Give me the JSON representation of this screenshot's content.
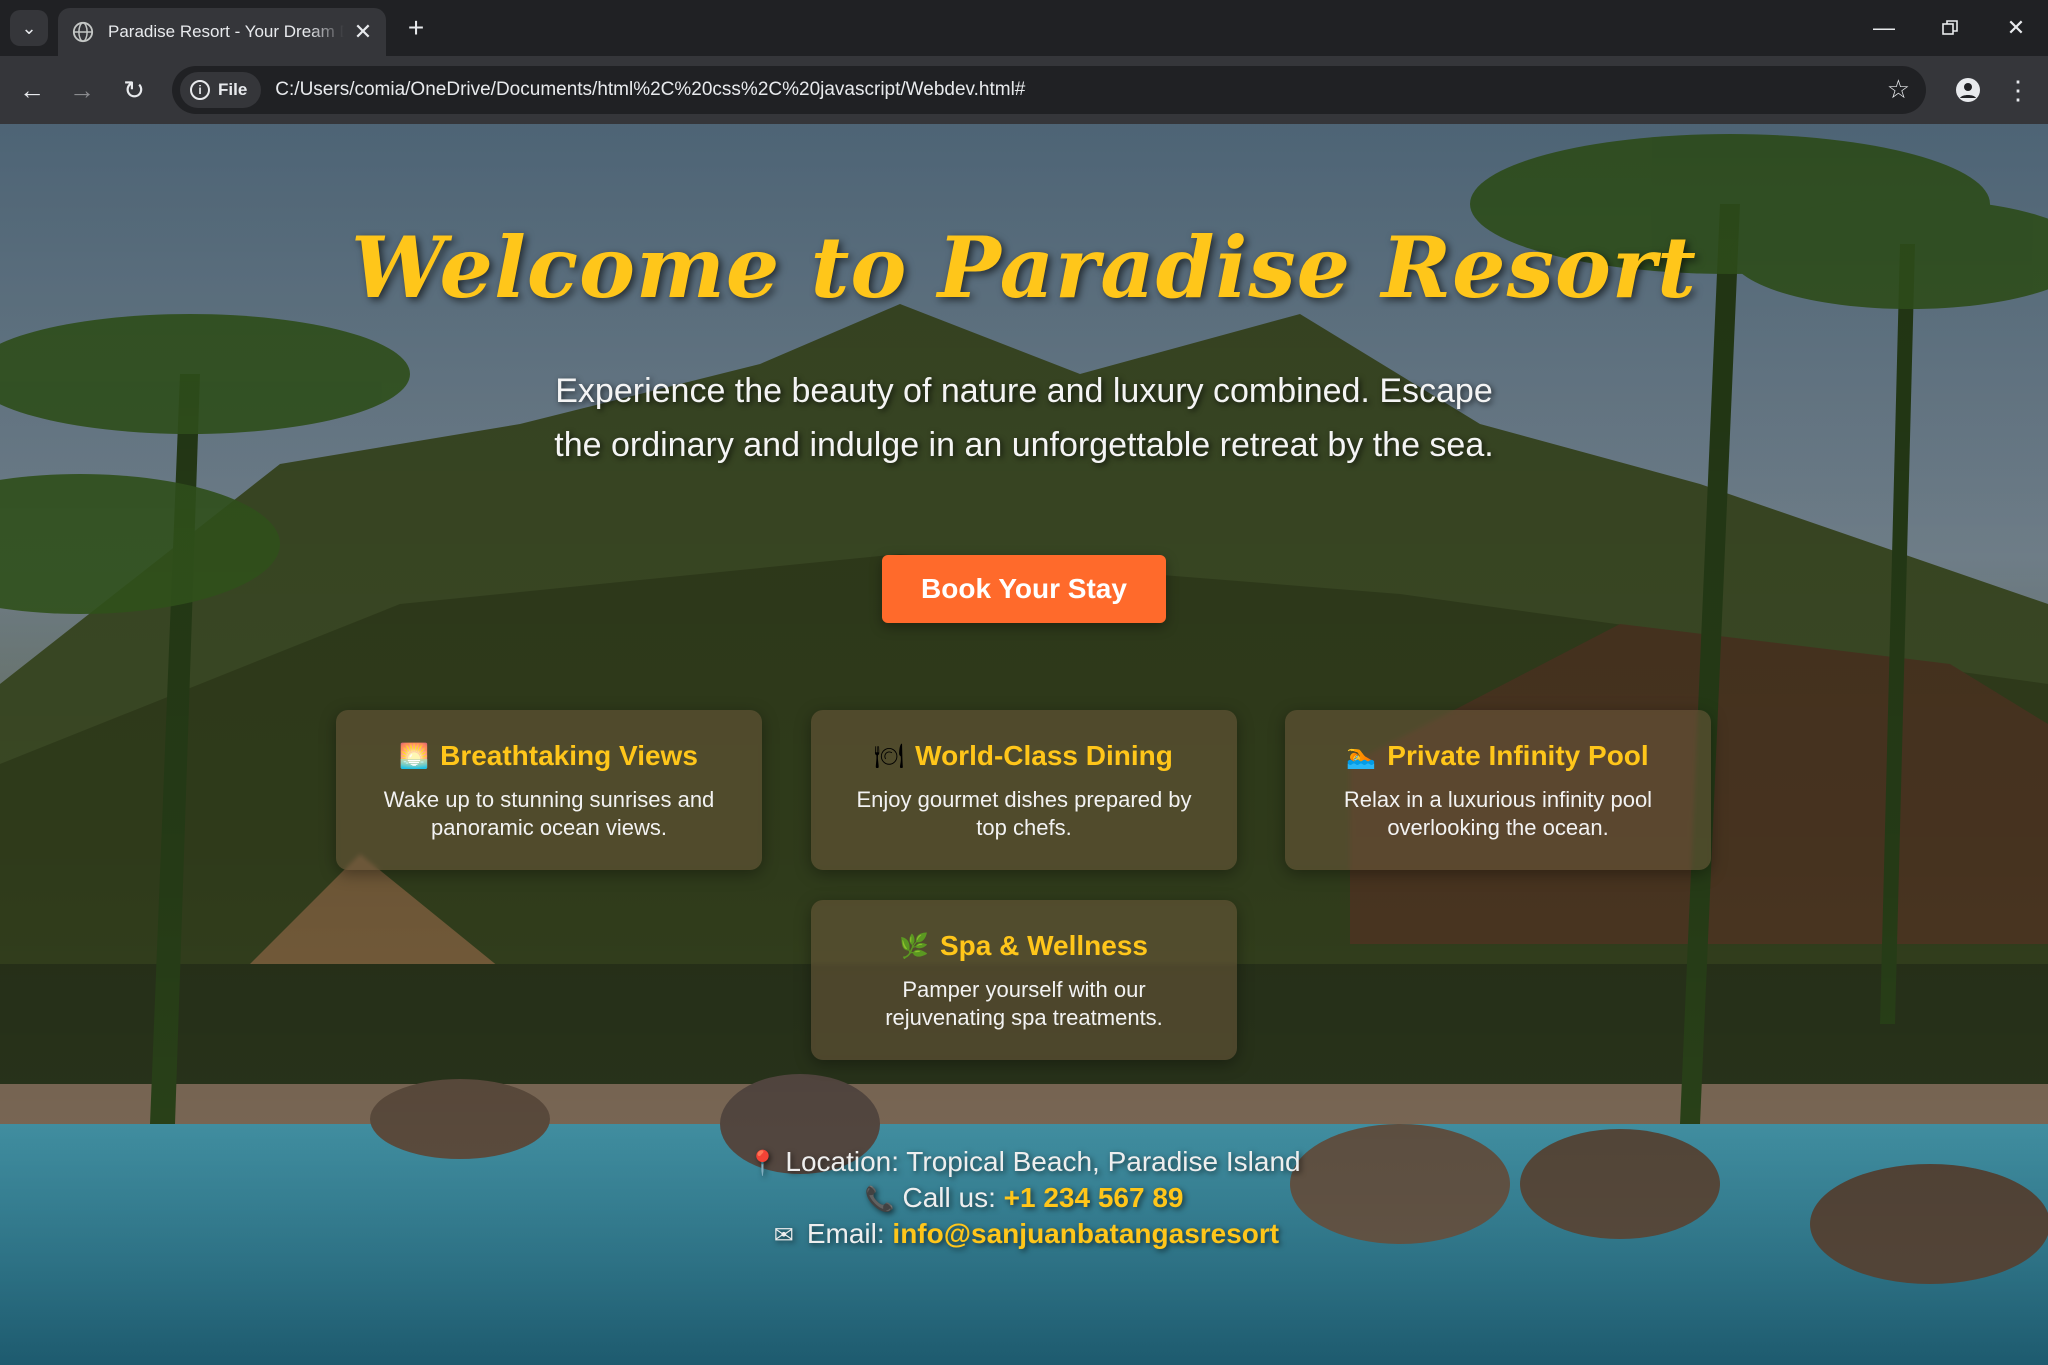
{
  "browser": {
    "tab_title": "Paradise Resort - Your Dream Destination",
    "url_chip": "File",
    "url": "C:/Users/comia/OneDrive/Documents/html%2C%20css%2C%20javascript/Webdev.html#",
    "icons": {
      "tab_search": "chevron-down-icon",
      "favicon": "globe-icon",
      "close": "close-icon",
      "new_tab": "plus-icon",
      "back": "back-arrow-icon",
      "forward": "forward-arrow-icon",
      "reload": "reload-icon",
      "info": "info-icon",
      "bookmark": "star-icon",
      "profile": "profile-icon",
      "menu": "kebab-menu-icon",
      "minimize": "minimize-icon",
      "restore": "restore-icon",
      "window_close": "close-icon"
    }
  },
  "hero": {
    "title": "Welcome to Paradise Resort",
    "subtitle": "Experience the beauty of nature and luxury combined. Escape the ordinary and indulge in an unforgettable retreat by the sea.",
    "cta_label": "Book Your Stay"
  },
  "features": [
    {
      "icon": "sunrise-icon",
      "title": "Breathtaking Views",
      "text": "Wake up to stunning sunrises and panoramic ocean views."
    },
    {
      "icon": "plate-icon",
      "title": "World-Class Dining",
      "text": "Enjoy gourmet dishes prepared by top chefs."
    },
    {
      "icon": "swimmer-icon",
      "title": "Private Infinity Pool",
      "text": "Relax in a luxurious infinity pool overlooking the ocean."
    },
    {
      "icon": "herb-icon",
      "title": "Spa & Wellness",
      "text": "Pamper yourself with our rejuvenating spa treatments."
    }
  ],
  "contact": {
    "location": "Location: Tropical Beach, Paradise Island",
    "phone_label": "Call us:",
    "phone": "+1 234 567 89",
    "email_label": "Email:",
    "email": "info@sanjuanbatangasresort",
    "icons": {
      "location": "pin-icon",
      "phone": "phone-icon",
      "email": "envelope-icon"
    }
  },
  "colors": {
    "accent": "#ffc61a",
    "button": "#ff6a2b",
    "chrome_dark": "#202124",
    "chrome_toolbar": "#35363a"
  }
}
